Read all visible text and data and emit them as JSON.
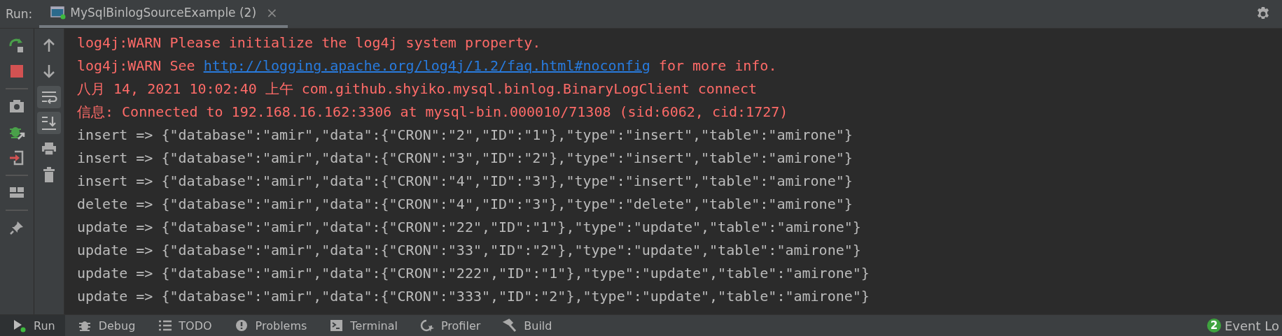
{
  "run_panel": {
    "label": "Run:",
    "tab": {
      "title": "MySqlBinlogSourceExample (2)",
      "selected": true,
      "close": "×"
    }
  },
  "left_toolbar": [
    {
      "selected": false
    },
    {
      "selected": false
    },
    {
      "selected": false
    },
    {
      "selected": false
    },
    {
      "selected": false
    },
    {
      "selected": false
    },
    {
      "selected": false
    }
  ],
  "console_toolbar": [
    {
      "selected": false
    },
    {
      "selected": false
    },
    {
      "selected": true
    },
    {
      "selected": true
    },
    {
      "selected": false
    },
    {
      "selected": false
    }
  ],
  "console": [
    {
      "kind": "error",
      "segments": [
        {
          "kind": "text",
          "text": "log4j:WARN Please initialize the log4j system property."
        }
      ]
    },
    {
      "kind": "error",
      "segments": [
        {
          "kind": "text",
          "text": "log4j:WARN See "
        },
        {
          "kind": "link",
          "text": "http://logging.apache.org/log4j/1.2/faq.html#noconfig"
        },
        {
          "kind": "text",
          "text": " for more info."
        }
      ]
    },
    {
      "kind": "error",
      "segments": [
        {
          "kind": "text",
          "text": "八月 14, 2021 10:02:40 上午 com.github.shyiko.mysql.binlog.BinaryLogClient connect"
        }
      ]
    },
    {
      "kind": "error",
      "segments": [
        {
          "kind": "text",
          "text": "信息: Connected to 192.168.16.162:3306 at mysql-bin.000010/71308 (sid:6062, cid:1727)"
        }
      ]
    },
    {
      "kind": "output",
      "segments": [
        {
          "kind": "text",
          "text": "insert => {\"database\":\"amir\",\"data\":{\"CRON\":\"2\",\"ID\":\"1\"},\"type\":\"insert\",\"table\":\"amirone\"}"
        }
      ]
    },
    {
      "kind": "output",
      "segments": [
        {
          "kind": "text",
          "text": "insert => {\"database\":\"amir\",\"data\":{\"CRON\":\"3\",\"ID\":\"2\"},\"type\":\"insert\",\"table\":\"amirone\"}"
        }
      ]
    },
    {
      "kind": "output",
      "segments": [
        {
          "kind": "text",
          "text": "insert => {\"database\":\"amir\",\"data\":{\"CRON\":\"4\",\"ID\":\"3\"},\"type\":\"insert\",\"table\":\"amirone\"}"
        }
      ]
    },
    {
      "kind": "output",
      "segments": [
        {
          "kind": "text",
          "text": "delete => {\"database\":\"amir\",\"data\":{\"CRON\":\"4\",\"ID\":\"3\"},\"type\":\"delete\",\"table\":\"amirone\"}"
        }
      ]
    },
    {
      "kind": "output",
      "segments": [
        {
          "kind": "text",
          "text": "update => {\"database\":\"amir\",\"data\":{\"CRON\":\"22\",\"ID\":\"1\"},\"type\":\"update\",\"table\":\"amirone\"}"
        }
      ]
    },
    {
      "kind": "output",
      "segments": [
        {
          "kind": "text",
          "text": "update => {\"database\":\"amir\",\"data\":{\"CRON\":\"33\",\"ID\":\"2\"},\"type\":\"update\",\"table\":\"amirone\"}"
        }
      ]
    },
    {
      "kind": "output",
      "segments": [
        {
          "kind": "text",
          "text": "update => {\"database\":\"amir\",\"data\":{\"CRON\":\"222\",\"ID\":\"1\"},\"type\":\"update\",\"table\":\"amirone\"}"
        }
      ]
    },
    {
      "kind": "output",
      "segments": [
        {
          "kind": "text",
          "text": "update => {\"database\":\"amir\",\"data\":{\"CRON\":\"333\",\"ID\":\"2\"},\"type\":\"update\",\"table\":\"amirone\"}"
        }
      ]
    }
  ],
  "bottom_tabs": [
    {
      "label": "Run",
      "selected": true
    },
    {
      "label": "Debug",
      "selected": false
    },
    {
      "label": "TODO",
      "selected": false
    },
    {
      "label": "Problems",
      "selected": false
    },
    {
      "label": "Terminal",
      "selected": false
    },
    {
      "label": "Profiler",
      "selected": false
    },
    {
      "label": "Build",
      "selected": false
    }
  ],
  "event_log": {
    "count": "2",
    "label": "Event Lo"
  }
}
